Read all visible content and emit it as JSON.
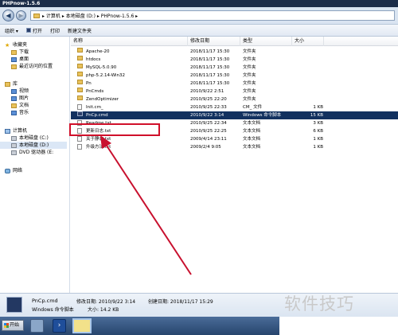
{
  "window": {
    "title": "PHPnow-1.5.6"
  },
  "address": {
    "parts": [
      "▸ 计算机 ▸ 本地磁盘 (D:) ▸ PHPnow-1.5.6 ▸"
    ]
  },
  "toolbar": {
    "organize": "组织 ▾",
    "open": "打开",
    "print": "打印",
    "new_folder": "新建文件夹"
  },
  "nav": {
    "favorites": "收藏夹",
    "downloads": "下载",
    "desktop": "桌面",
    "recent": "最近访问的位置",
    "libraries": "库",
    "videos": "视频",
    "pictures": "图片",
    "documents": "文档",
    "music": "音乐",
    "computer": "计算机",
    "drive_c": "本地磁盘 (C:)",
    "drive_d": "本地磁盘 (D:)",
    "drive_dvd": "DVD 驱动器 (E:",
    "network": "网络"
  },
  "columns": {
    "name": "名称",
    "modified": "修改日期",
    "type": "类型",
    "size": "大小"
  },
  "files": [
    {
      "name": "Apache-20",
      "date": "2018/11/17 15:30",
      "type": "文件夹",
      "size": "",
      "kind": "folder"
    },
    {
      "name": "htdocs",
      "date": "2018/11/17 15:30",
      "type": "文件夹",
      "size": "",
      "kind": "folder"
    },
    {
      "name": "MySQL-5.0.90",
      "date": "2018/11/17 15:30",
      "type": "文件夹",
      "size": "",
      "kind": "folder"
    },
    {
      "name": "php-5.2.14-Win32",
      "date": "2018/11/17 15:30",
      "type": "文件夹",
      "size": "",
      "kind": "folder"
    },
    {
      "name": "Pn",
      "date": "2018/11/17 15:30",
      "type": "文件夹",
      "size": "",
      "kind": "folder"
    },
    {
      "name": "PnCmds",
      "date": "2010/9/22 2:51",
      "type": "文件夹",
      "size": "",
      "kind": "folder"
    },
    {
      "name": "ZendOptimizer",
      "date": "2010/9/25 22:20",
      "type": "文件夹",
      "size": "",
      "kind": "folder"
    },
    {
      "name": "Init.cm_",
      "date": "2010/9/25 22:33",
      "type": "CM_ 文件",
      "size": "1 KB",
      "kind": "file"
    },
    {
      "name": "PnCp.cmd",
      "date": "2010/9/22 3:14",
      "type": "Windows 命令脚本",
      "size": "15 KB",
      "kind": "cmd",
      "selected": true
    },
    {
      "name": "Readme.txt",
      "date": "2010/9/25 22:34",
      "type": "文本文档",
      "size": "3 KB",
      "kind": "file"
    },
    {
      "name": "更新日志.txt",
      "date": "2010/9/25 22:25",
      "type": "文本文档",
      "size": "6 KB",
      "kind": "file"
    },
    {
      "name": "关于静态.txt",
      "date": "2009/4/14 23:11",
      "type": "文本文档",
      "size": "1 KB",
      "kind": "file"
    },
    {
      "name": "升级方法.txt",
      "date": "2009/2/4 9:05",
      "type": "文本文档",
      "size": "1 KB",
      "kind": "file"
    }
  ],
  "details": {
    "name": "PnCp.cmd",
    "modified_label": "修改日期: 2010/9/22 3:14",
    "created_label": "创建日期: 2018/11/17 15:29",
    "type": "Windows 命令脚本",
    "size_label": "大小: 14.2 KB"
  },
  "taskbar": {
    "start": "开始"
  },
  "watermark": "软件技巧",
  "colors": {
    "selection": "#12315f",
    "highlight": "#d0102a",
    "arrow": "#c8102e"
  }
}
